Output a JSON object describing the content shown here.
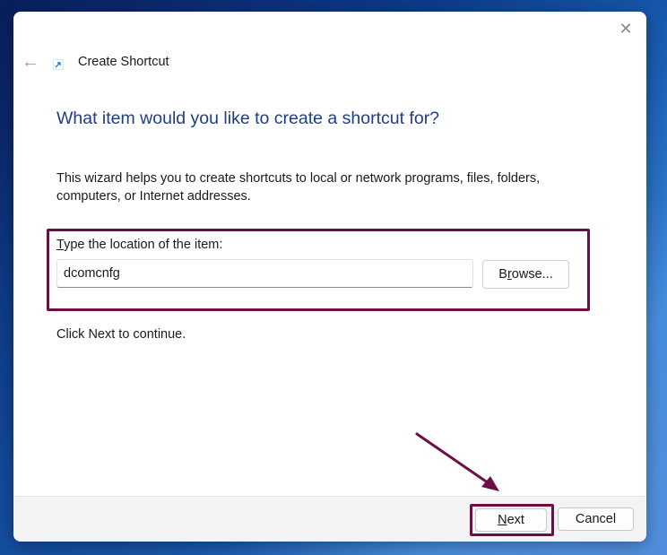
{
  "window": {
    "title": "Create Shortcut",
    "close_glyph": "✕",
    "back_glyph": "←"
  },
  "wizard": {
    "heading": "What item would you like to create a shortcut for?",
    "description": "This wizard helps you to create shortcuts to local or network programs, files, folders, computers, or Internet addresses.",
    "location_label_first": "T",
    "location_label_rest": "ype the location of the item:",
    "location_value": "dcomcnfg",
    "browse_first": "B",
    "browse_ul": "r",
    "browse_rest": "owse...",
    "continue_text": "Click Next to continue."
  },
  "footer": {
    "next_ul": "N",
    "next_rest": "ext",
    "cancel_label": "Cancel"
  },
  "icons": {
    "close": "close-icon",
    "back": "back-arrow-icon",
    "shortcut": "shortcut-icon"
  },
  "colors": {
    "heading": "#1f3e86",
    "annotation": "#6d0f45",
    "footer_bg": "#f3f3f3"
  }
}
